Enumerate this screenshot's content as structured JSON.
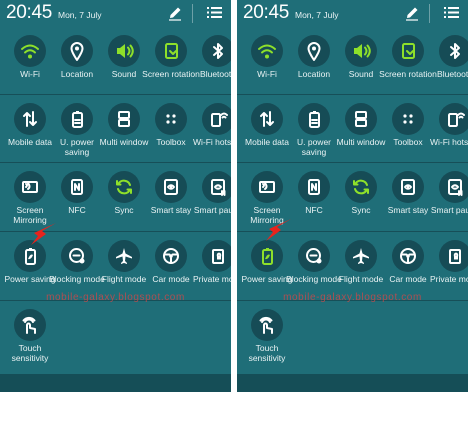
{
  "status": {
    "time": "20:45",
    "date": "Mon, 7 July"
  },
  "watermark": "mobile-galaxy.blogspot.com",
  "panels": [
    {
      "id": "left",
      "tiles": [
        {
          "label": "Wi-Fi",
          "icon": "wifi-icon",
          "active": true
        },
        {
          "label": "Location",
          "icon": "location-icon",
          "active": false
        },
        {
          "label": "Sound",
          "icon": "sound-icon",
          "active": true
        },
        {
          "label": "Screen rotation",
          "icon": "screen-rotation-icon",
          "active": true
        },
        {
          "label": "Bluetooth",
          "icon": "bluetooth-icon",
          "active": false
        },
        {
          "label": "Mobile data",
          "icon": "mobile-data-icon",
          "active": false
        },
        {
          "label": "U. power saving",
          "icon": "ultra-power-saving-icon",
          "active": false
        },
        {
          "label": "Multi window",
          "icon": "multi-window-icon",
          "active": false
        },
        {
          "label": "Toolbox",
          "icon": "toolbox-icon",
          "active": false
        },
        {
          "label": "Wi-Fi hotspot",
          "icon": "wifi-hotspot-icon",
          "active": false
        },
        {
          "label": "Screen Mirroring",
          "icon": "screen-mirroring-icon",
          "active": false
        },
        {
          "label": "NFC",
          "icon": "nfc-icon",
          "active": false
        },
        {
          "label": "Sync",
          "icon": "sync-icon",
          "active": true
        },
        {
          "label": "Smart stay",
          "icon": "smart-stay-icon",
          "active": false
        },
        {
          "label": "Smart pause",
          "icon": "smart-pause-icon",
          "active": false
        },
        {
          "label": "Power saving",
          "icon": "power-saving-icon",
          "active": false
        },
        {
          "label": "Blocking mode",
          "icon": "blocking-mode-icon",
          "active": false
        },
        {
          "label": "Flight mode",
          "icon": "flight-mode-icon",
          "active": false
        },
        {
          "label": "Car mode",
          "icon": "car-mode-icon",
          "active": false
        },
        {
          "label": "Private mode",
          "icon": "private-mode-icon",
          "active": false
        },
        {
          "label": "Touch sensitivity",
          "icon": "touch-sensitivity-icon",
          "active": false
        }
      ]
    },
    {
      "id": "right",
      "tiles": [
        {
          "label": "Wi-Fi",
          "icon": "wifi-icon",
          "active": true
        },
        {
          "label": "Location",
          "icon": "location-icon",
          "active": false
        },
        {
          "label": "Sound",
          "icon": "sound-icon",
          "active": true
        },
        {
          "label": "Screen rotation",
          "icon": "screen-rotation-icon",
          "active": true
        },
        {
          "label": "Bluetooth",
          "icon": "bluetooth-icon",
          "active": false
        },
        {
          "label": "Mobile data",
          "icon": "mobile-data-icon",
          "active": false
        },
        {
          "label": "U. power saving",
          "icon": "ultra-power-saving-icon",
          "active": false
        },
        {
          "label": "Multi window",
          "icon": "multi-window-icon",
          "active": false
        },
        {
          "label": "Toolbox",
          "icon": "toolbox-icon",
          "active": false
        },
        {
          "label": "Wi-Fi hotspot",
          "icon": "wifi-hotspot-icon",
          "active": false
        },
        {
          "label": "Screen Mirroring",
          "icon": "screen-mirroring-icon",
          "active": false
        },
        {
          "label": "NFC",
          "icon": "nfc-icon",
          "active": false
        },
        {
          "label": "Sync",
          "icon": "sync-icon",
          "active": true
        },
        {
          "label": "Smart stay",
          "icon": "smart-stay-icon",
          "active": false
        },
        {
          "label": "Smart pause",
          "icon": "smart-pause-icon",
          "active": false
        },
        {
          "label": "Power saving",
          "icon": "power-saving-icon",
          "active": true
        },
        {
          "label": "Blocking mode",
          "icon": "blocking-mode-icon",
          "active": false
        },
        {
          "label": "Flight mode",
          "icon": "flight-mode-icon",
          "active": false
        },
        {
          "label": "Car mode",
          "icon": "car-mode-icon",
          "active": false
        },
        {
          "label": "Private mode",
          "icon": "private-mode-icon",
          "active": false
        },
        {
          "label": "Touch sensitivity",
          "icon": "touch-sensitivity-icon",
          "active": false
        }
      ]
    }
  ],
  "colors": {
    "background": "#1f6e78",
    "tile_circle": "#164c56",
    "icon_inactive": "#ffffff",
    "icon_active": "#8ee02a",
    "arrow": "#e8231d"
  }
}
